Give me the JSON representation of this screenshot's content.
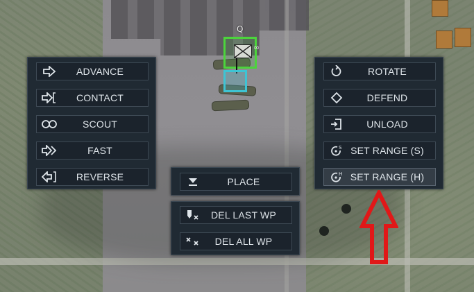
{
  "map": {
    "unit_label": "Q",
    "unit_tag": "∞"
  },
  "left_panel": {
    "buttons": [
      {
        "label": "ADVANCE",
        "icon": "advance-arrow-icon"
      },
      {
        "label": "CONTACT",
        "icon": "contact-arrow-icon"
      },
      {
        "label": "SCOUT",
        "icon": "scout-binoculars-icon"
      },
      {
        "label": "FAST",
        "icon": "fast-double-arrow-icon"
      },
      {
        "label": "REVERSE",
        "icon": "reverse-arrow-icon"
      }
    ]
  },
  "center_panel": {
    "place": {
      "label": "PLACE",
      "icon": "place-down-icon"
    },
    "del_last": {
      "label": "DEL LAST WP",
      "icon": "delete-last-waypoint-icon"
    },
    "del_all": {
      "label": "DEL ALL WP",
      "icon": "delete-all-waypoints-icon"
    }
  },
  "right_panel": {
    "buttons": [
      {
        "label": "ROTATE",
        "icon": "rotate-icon"
      },
      {
        "label": "DEFEND",
        "icon": "defend-diamond-icon"
      },
      {
        "label": "UNLOAD",
        "icon": "unload-icon"
      },
      {
        "label": "SET RANGE (S)",
        "icon": "set-range-soft-icon"
      },
      {
        "label": "SET RANGE (H)",
        "icon": "set-range-hard-icon",
        "highlighted": true
      }
    ]
  },
  "colors": {
    "panel_bg": "#202a33",
    "button_bg": "#1b232c",
    "text": "#dfe5ea",
    "selection_green": "#4cd43c",
    "waypoint_cyan": "#3ec4d4",
    "annotation_arrow": "#e01818"
  }
}
